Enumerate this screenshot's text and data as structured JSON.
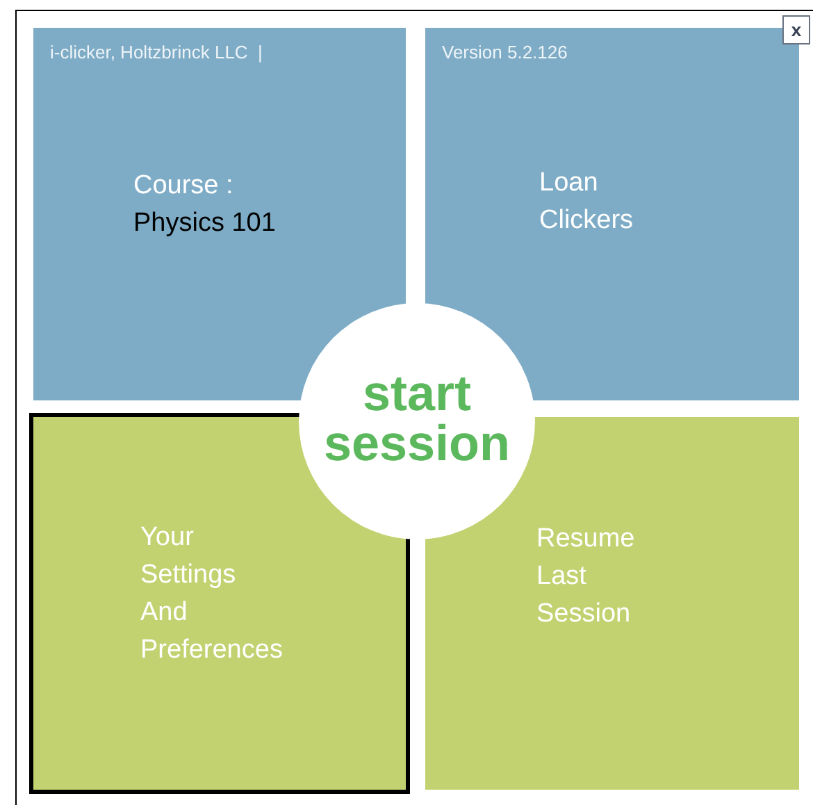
{
  "tiles": [
    {
      "caption": "i-clicker, Holtzbrinck LLC  |",
      "lines": [
        "Course :"
      ],
      "value": "Physics 101",
      "color": "#7eacc6",
      "selected": false
    },
    {
      "caption": "Version 5.2.126",
      "lines": [
        "Loan",
        "Clickers"
      ],
      "color": "#7eacc6",
      "selected": false
    },
    {
      "lines": [
        "Your",
        "Settings",
        "And",
        "Preferences"
      ],
      "color": "#c3d270",
      "selected": true
    },
    {
      "lines": [
        "Resume",
        "Last",
        "Session"
      ],
      "color": "#c3d270",
      "selected": false
    }
  ],
  "start_button": [
    "start",
    "session"
  ],
  "close_button": "x"
}
